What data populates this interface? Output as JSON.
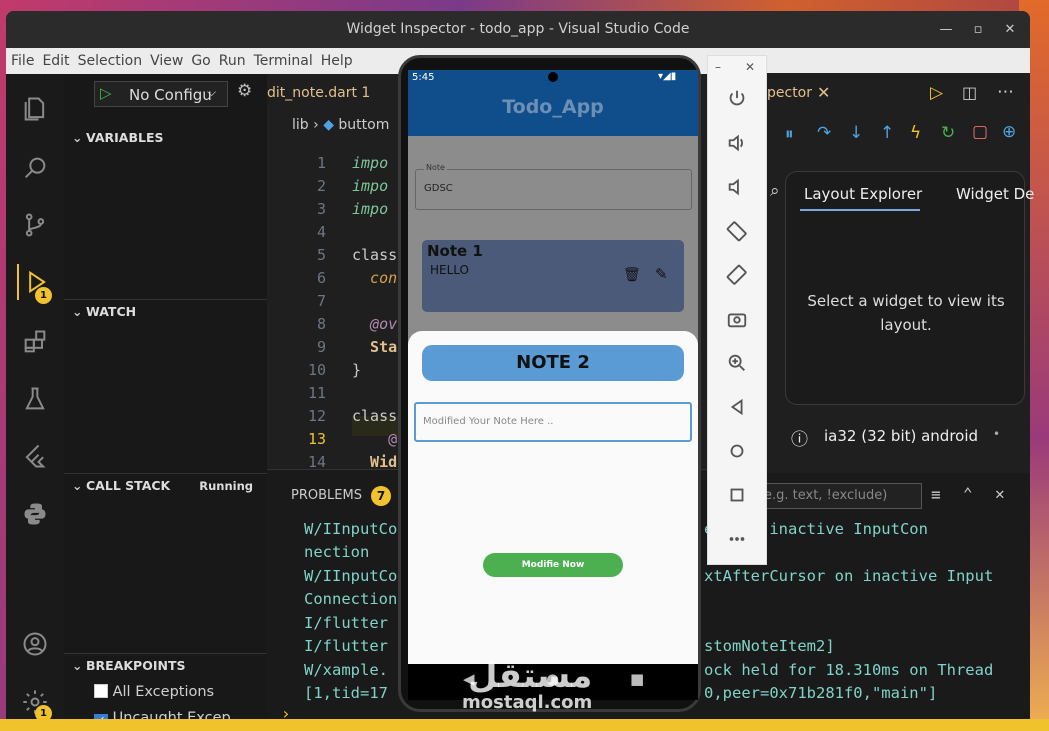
{
  "window": {
    "title": "Widget Inspector - todo_app - Visual Studio Code"
  },
  "menu": [
    "File",
    "Edit",
    "Selection",
    "View",
    "Go",
    "Run",
    "Terminal",
    "Help"
  ],
  "activity": {
    "run_badge": "1",
    "settings_badge": "1"
  },
  "run": {
    "config": "No Configu"
  },
  "sections": {
    "variables": "VARIABLES",
    "watch": "WATCH",
    "call_stack": "CALL STACK",
    "call_stack_status": "Running",
    "breakpoints": "BREAKPOINTS"
  },
  "breakpoints": [
    {
      "label": "All Exceptions",
      "checked": false
    },
    {
      "label": "Uncaught Excep…",
      "checked": true
    }
  ],
  "editor": {
    "tab": "dit_note.dart 1",
    "breadcrumb_root": "lib",
    "breadcrumb_file": "buttom",
    "current_line": "13",
    "lines": [
      {
        "n": "1",
        "t": "impo"
      },
      {
        "n": "2",
        "t": "impo"
      },
      {
        "n": "3",
        "t": "impo"
      },
      {
        "n": "4",
        "t": ""
      },
      {
        "n": "5",
        "t": "class"
      },
      {
        "n": "6",
        "t": "  con"
      },
      {
        "n": "7",
        "t": ""
      },
      {
        "n": "8",
        "t": "  @ov"
      },
      {
        "n": "9",
        "t": "  Sta"
      },
      {
        "n": "10",
        "t": "}"
      },
      {
        "n": "11",
        "t": ""
      },
      {
        "n": "12",
        "t": "class"
      },
      {
        "n": "13",
        "t": "    @"
      },
      {
        "n": "14",
        "t": "  Wid"
      }
    ]
  },
  "panel": {
    "problems": "PROBLEMS",
    "problems_count": "7",
    "filter_placeholder": "e.g. text, !exclude)",
    "lines": [
      {
        "l": "W/IInputCo",
        "r": "ext on inactive InputCon"
      },
      {
        "l": "nection",
        "r": ""
      },
      {
        "l": "W/IInputCo",
        "r": "xtAfterCursor on inactive Input"
      },
      {
        "l": "Connection",
        "r": ""
      },
      {
        "l": "I/flutter",
        "r": ""
      },
      {
        "l": "I/flutter",
        "r": "stomNoteItem2]"
      },
      {
        "l": "W/xample.",
        "r": "ock held for 18.310ms on Thread"
      },
      {
        "l": "[1,tid=17",
        "r": "0,peer=0x71b281f0,\"main\"]"
      }
    ]
  },
  "devtools": {
    "tab_partial": "pector",
    "tab1": "Layout Explorer",
    "tab2": "Widget De",
    "message": "Select a widget to view its layout.",
    "device": "ia32 (32 bit) android"
  },
  "phone": {
    "time": "5:45",
    "app_title": "Todo_App",
    "note_label": "Note",
    "note_value": "GDSC",
    "card_title": "Note 1",
    "card_body": "HELLO",
    "sheet_title": "NOTE 2",
    "sheet_placeholder": "Modified Your Note Here ..",
    "sheet_button": "Modifie Now"
  },
  "watermark": {
    "arabic": "مستقل",
    "latin": "mostaql.com"
  },
  "colors": {
    "accent": "#f0c22b",
    "app_bar": "#0f4e8a",
    "card": "#8aa2c8",
    "sheet_title_bg": "#5b9bd5",
    "button": "#4caf50"
  }
}
